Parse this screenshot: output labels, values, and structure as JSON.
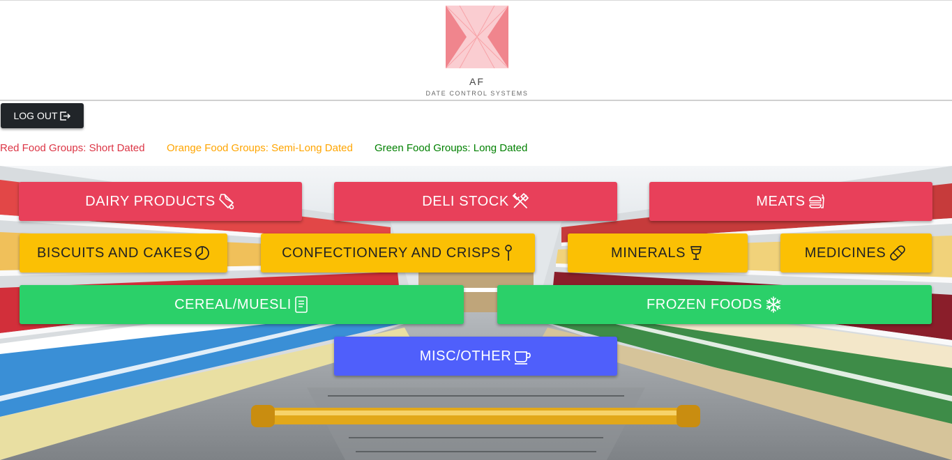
{
  "brand": {
    "initials": "AF",
    "tagline": "DATE CONTROL SYSTEMS",
    "logo_color": "#f2717a"
  },
  "logout": {
    "label": "LOG OUT",
    "icon": "logout-icon"
  },
  "legend": [
    {
      "text": "Red Food Groups: Short Dated",
      "color": "#dc3545"
    },
    {
      "text": "Orange Food Groups: Semi-Long Dated",
      "color": "#ffa500"
    },
    {
      "text": "Green Food Groups: Long Dated",
      "color": "#008000"
    }
  ],
  "categories": [
    {
      "label": "DAIRY PRODUCTS",
      "group": "red",
      "icon": "milk-carton-icon"
    },
    {
      "label": "DELI STOCK",
      "group": "red",
      "icon": "fork-knife-icon"
    },
    {
      "label": "MEATS",
      "group": "red",
      "icon": "burger-icon"
    },
    {
      "label": "BISCUITS AND CAKES",
      "group": "orange",
      "icon": "pie-chart-icon"
    },
    {
      "label": "CONFECTIONERY AND CRISPS",
      "group": "orange",
      "icon": "lollipop-icon"
    },
    {
      "label": "MINERALS",
      "group": "orange",
      "icon": "cup-icon"
    },
    {
      "label": "MEDICINES",
      "group": "orange",
      "icon": "bandage-icon"
    },
    {
      "label": "CEREAL/MUESLI",
      "group": "green",
      "icon": "journal-icon"
    },
    {
      "label": "FROZEN FOODS",
      "group": "green",
      "icon": "snowflake-icon"
    },
    {
      "label": "MISC/OTHER",
      "group": "blue",
      "icon": "coffee-cup-icon"
    }
  ],
  "colors": {
    "red": "#e8405a",
    "orange": "#fbc004",
    "green": "#2bd069",
    "blue": "#4f5ffb",
    "logout_bg": "#212529"
  }
}
